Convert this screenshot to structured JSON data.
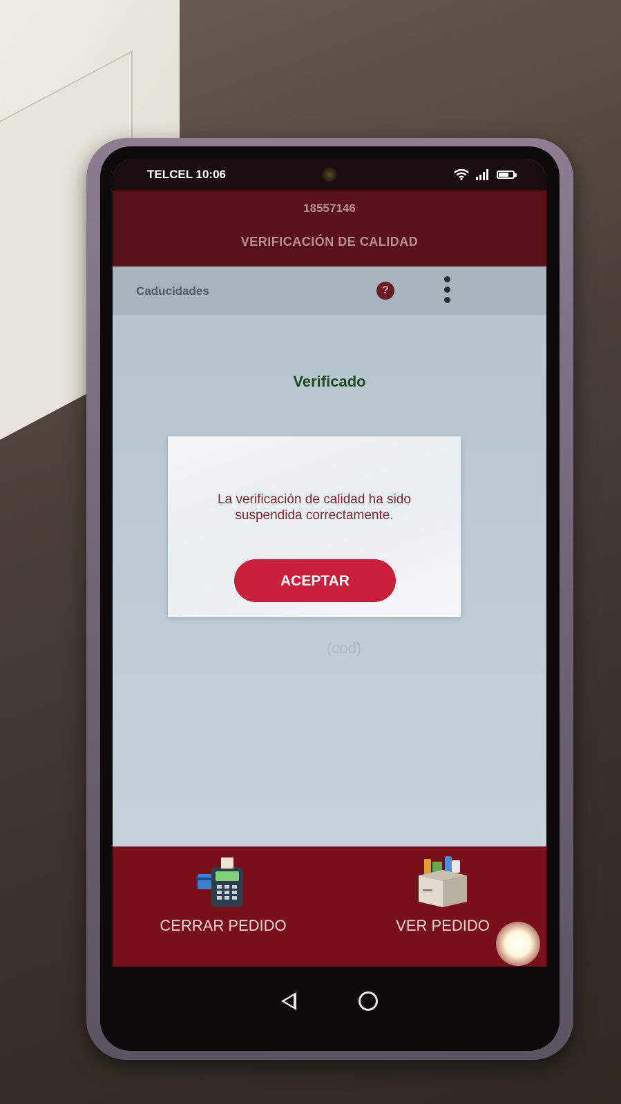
{
  "status_bar": {
    "carrier_time": "TELCEL 10:06",
    "icons": [
      "wifi-icon",
      "signal-icon",
      "battery-icon"
    ]
  },
  "header": {
    "order_number": "18557146",
    "title": "VERIFICACIÓN DE CALIDAD"
  },
  "tab": {
    "label": "Caducidades",
    "help_icon": "?",
    "menu_icon": "more-vertical-icon"
  },
  "content": {
    "status": "Verificado",
    "ghost_text": "(cod)"
  },
  "dialog": {
    "message": "La verificación de calidad ha sido suspendida correctamente.",
    "accept_label": "ACEPTAR"
  },
  "bottom_nav": {
    "close_order_label": "CERRAR PEDIDO",
    "view_order_label": "VER PEDIDO"
  },
  "colors": {
    "brand": "#7a0f1c",
    "accept_button": "#c8203a",
    "verified_text": "#1f4b1c"
  }
}
